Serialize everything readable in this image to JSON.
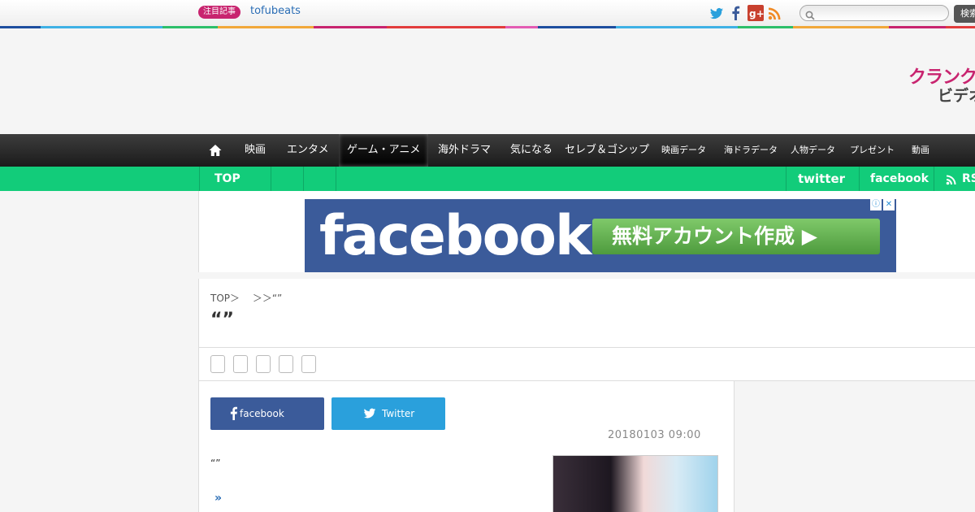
{
  "topbar": {
    "hot_badge": "注目記事",
    "hot_link": "tofubeats",
    "search": {
      "placeholder": "",
      "button_label": "検索"
    }
  },
  "header": {
    "logo_line1": "クランクイ",
    "logo_line2": "ビデオ"
  },
  "nav": {
    "items": [
      "映画",
      "エンタメ",
      "ゲーム・アニメ",
      "海外ドラマ",
      "気になる",
      "セレブ＆ゴシップ",
      "映画データ",
      "海ドラデータ",
      "人物データ",
      "プレゼント",
      "動画"
    ],
    "active_index": 2
  },
  "subnav": {
    "top": "TOP",
    "twitter": "twitter",
    "facebook": "facebook",
    "rss": "RSS"
  },
  "ad": {
    "brand": "facebook",
    "cta": "無料アカウント作成 ▶",
    "info": "ⓘ",
    "close": "✕"
  },
  "article": {
    "breadcrumb": "TOP＞　 ＞＞“”",
    "title": "“”",
    "share_buttons": {
      "facebook": "facebook",
      "twitter": "Twitter"
    },
    "date": "20180103 09:00",
    "body_quote": "“”",
    "more": "»"
  },
  "colors": {
    "brand": "#c8246f",
    "green": "#12cc7a",
    "facebook": "#3b5b9a",
    "twitter": "#2aa0dc",
    "strip": [
      "#1d4e9e",
      "#3fb1e5",
      "#2dbf6a",
      "#f1a83a",
      "#c8246f",
      "#e23c3c",
      "#e35cb3",
      "#1d4e9e",
      "#3fb1e5",
      "#2dbf6a",
      "#f1a83a",
      "#c8246f",
      "#e23c3c"
    ]
  }
}
